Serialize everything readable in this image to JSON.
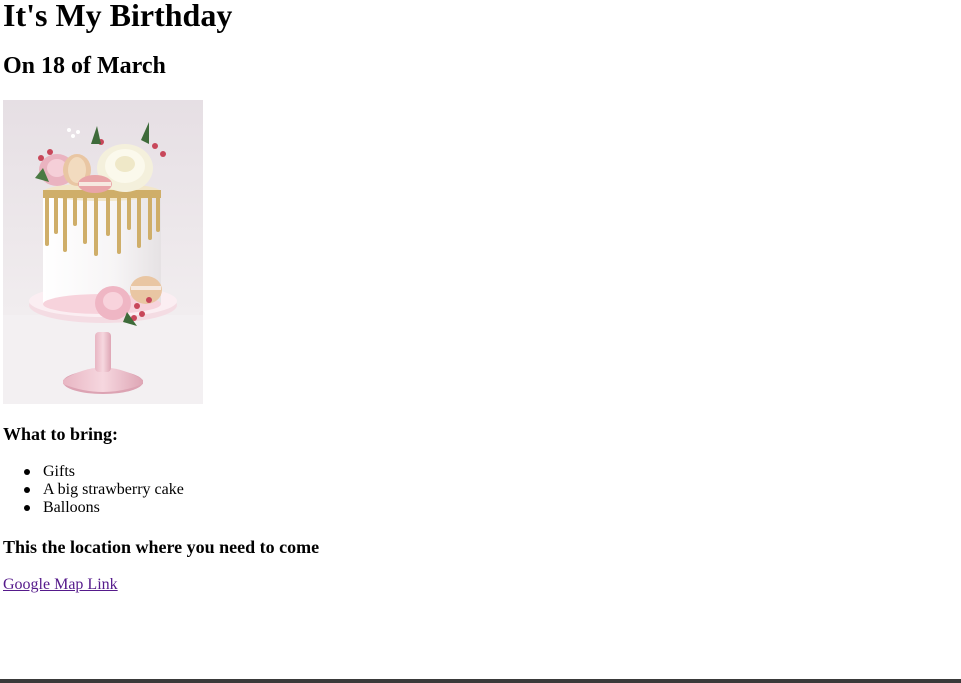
{
  "header": {
    "title": "It's My Birthday",
    "date_line": "On 18 of March"
  },
  "image": {
    "icon": "birthday-cake-image",
    "alt": "Birthday cake"
  },
  "bring": {
    "heading": "What to bring:",
    "items": [
      "Gifts",
      "A big strawberry cake",
      "Balloons"
    ]
  },
  "location": {
    "heading": "This the location where you need to come",
    "link_label": "Google Map Link"
  },
  "colors": {
    "visited_link": "#551a8b",
    "bottom_bar": "#3a3a3a"
  }
}
